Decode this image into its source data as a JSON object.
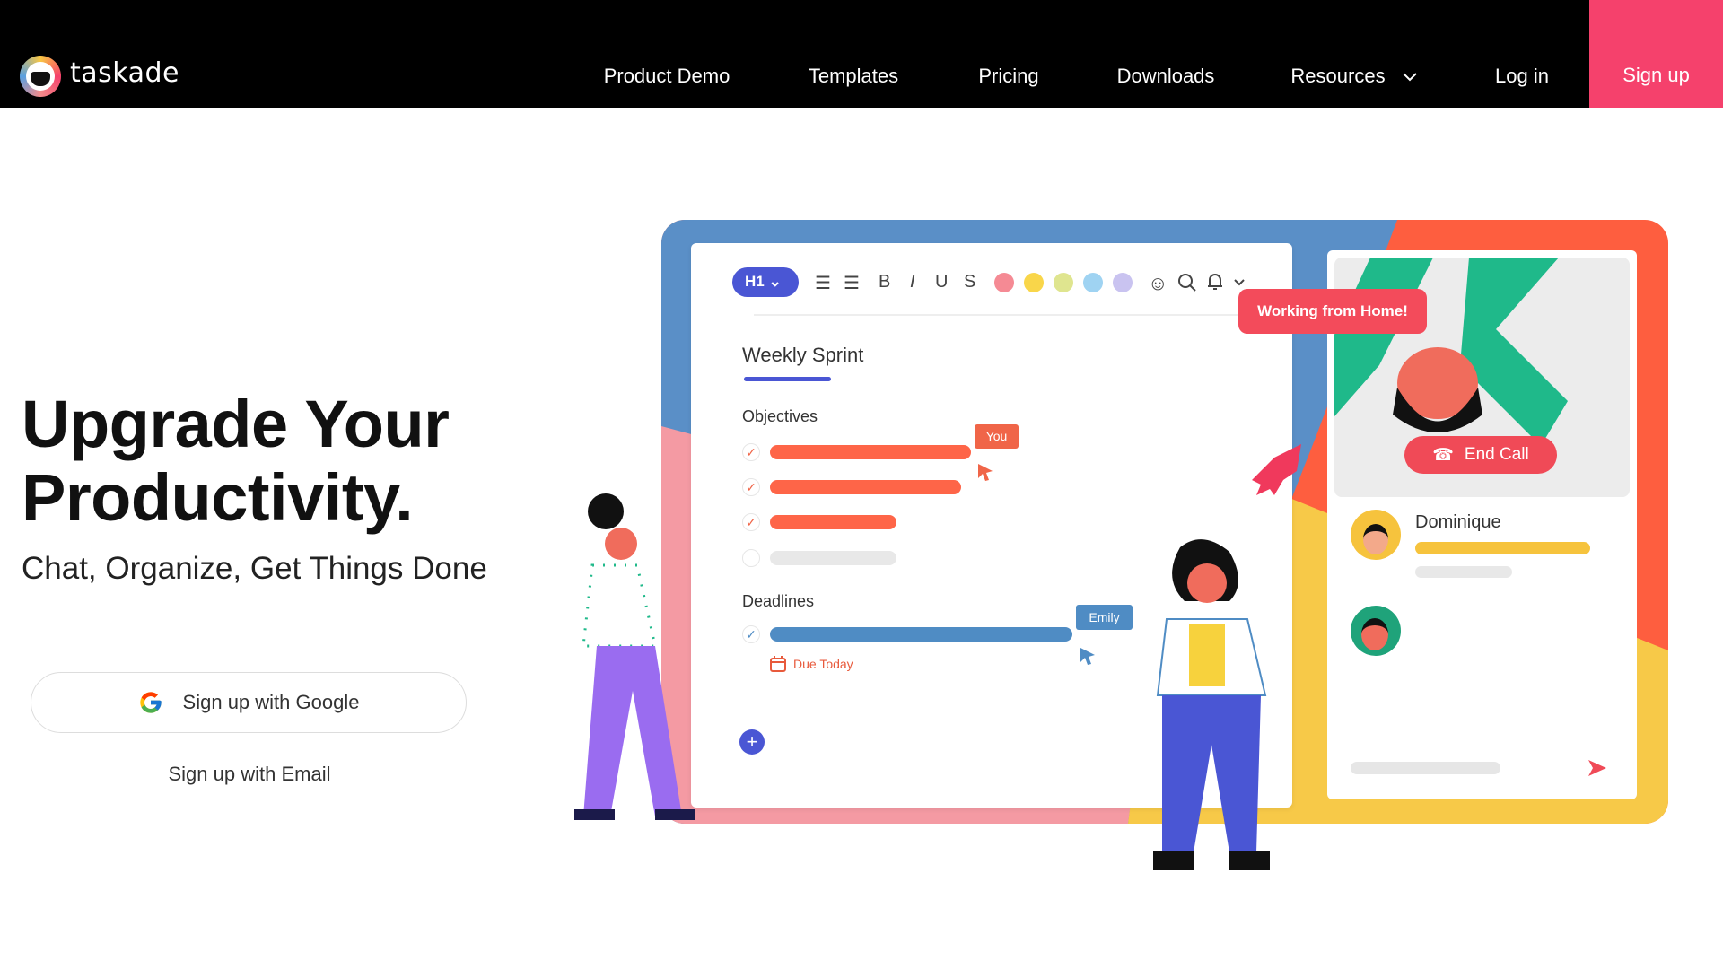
{
  "nav": {
    "logo_text": "taskade",
    "links": [
      "Product Demo",
      "Templates",
      "Pricing",
      "Downloads",
      "Resources",
      "Log in"
    ],
    "signup": "Sign up"
  },
  "hero": {
    "title_line1": "Upgrade Your",
    "title_line2": "Productivity.",
    "subtitle": "Chat, Organize, Get Things Done",
    "google_button": "Sign up with Google",
    "email_link": "Sign up with Email"
  },
  "illustration": {
    "toolbar": {
      "heading": "H1",
      "bold": "B",
      "italic": "I",
      "underline": "U",
      "strike": "S",
      "colors": [
        "#f58a94",
        "#f9d64a",
        "#dfe58f",
        "#9fd3f2",
        "#c9c3f0"
      ]
    },
    "doc_title": "Weekly Sprint",
    "objectives_label": "Objectives",
    "objectives_progress": [
      1.0,
      0.95,
      0.63,
      0.63
    ],
    "you_tag": "You",
    "deadlines_label": "Deadlines",
    "emily_tag": "Emily",
    "due_label": "Due Today",
    "bubble": "Working from Home!",
    "end_call": "End Call",
    "participant_name": "Dominique"
  },
  "colors": {
    "brand_pink": "#f5416c",
    "accent_blue": "#4a56d4",
    "orange": "#fe6548",
    "deadline_blue": "#4f8cc4",
    "yellow": "#f6c33d"
  }
}
